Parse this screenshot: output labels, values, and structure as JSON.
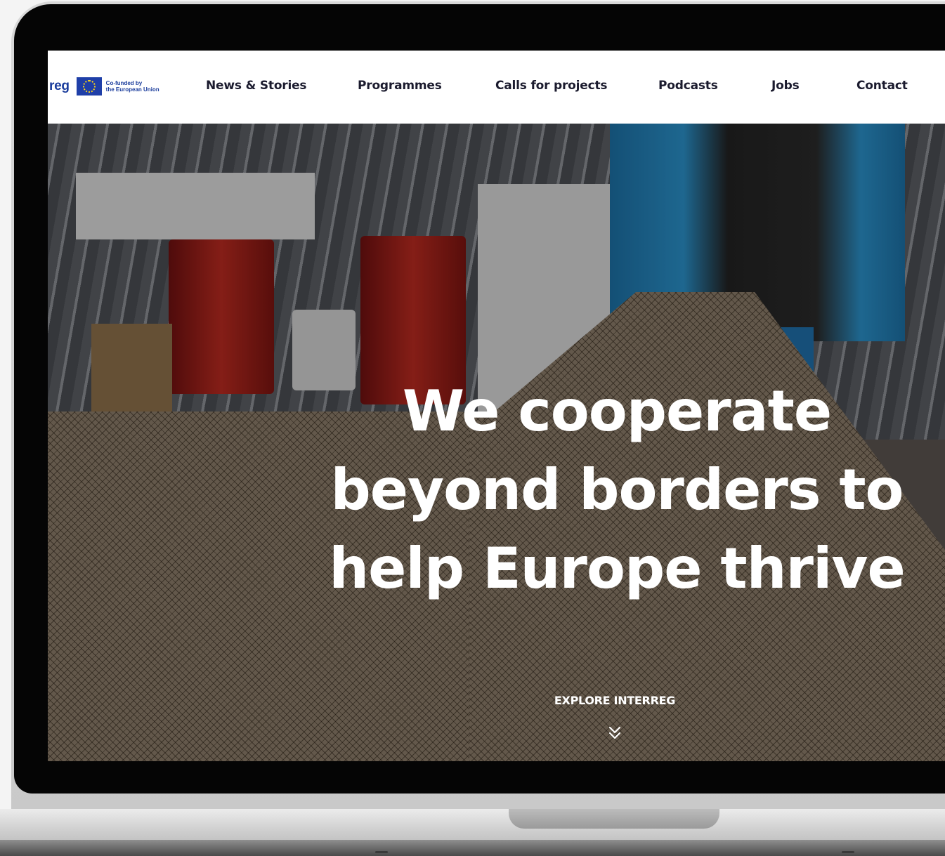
{
  "brand": {
    "logo_text": "reg",
    "eu_caption_line1": "Co-funded by",
    "eu_caption_line2": "the European Union"
  },
  "nav": {
    "items": [
      {
        "label": "News & Stories"
      },
      {
        "label": "Programmes"
      },
      {
        "label": "Calls for projects"
      },
      {
        "label": "Podcasts"
      },
      {
        "label": "Jobs"
      },
      {
        "label": "Contact"
      }
    ]
  },
  "hero": {
    "headline_line1": "We cooperate",
    "headline_line2": "beyond borders to",
    "headline_line3": "help Europe thrive",
    "cta_label": "EXPLORE INTERREG",
    "cta_icon": "double-chevron-down-icon"
  },
  "colors": {
    "brand_blue": "#1a3c9c",
    "eu_flag_blue": "#1f3fa8",
    "eu_star_yellow": "#ffd617",
    "nav_text": "#1b1b2e"
  }
}
